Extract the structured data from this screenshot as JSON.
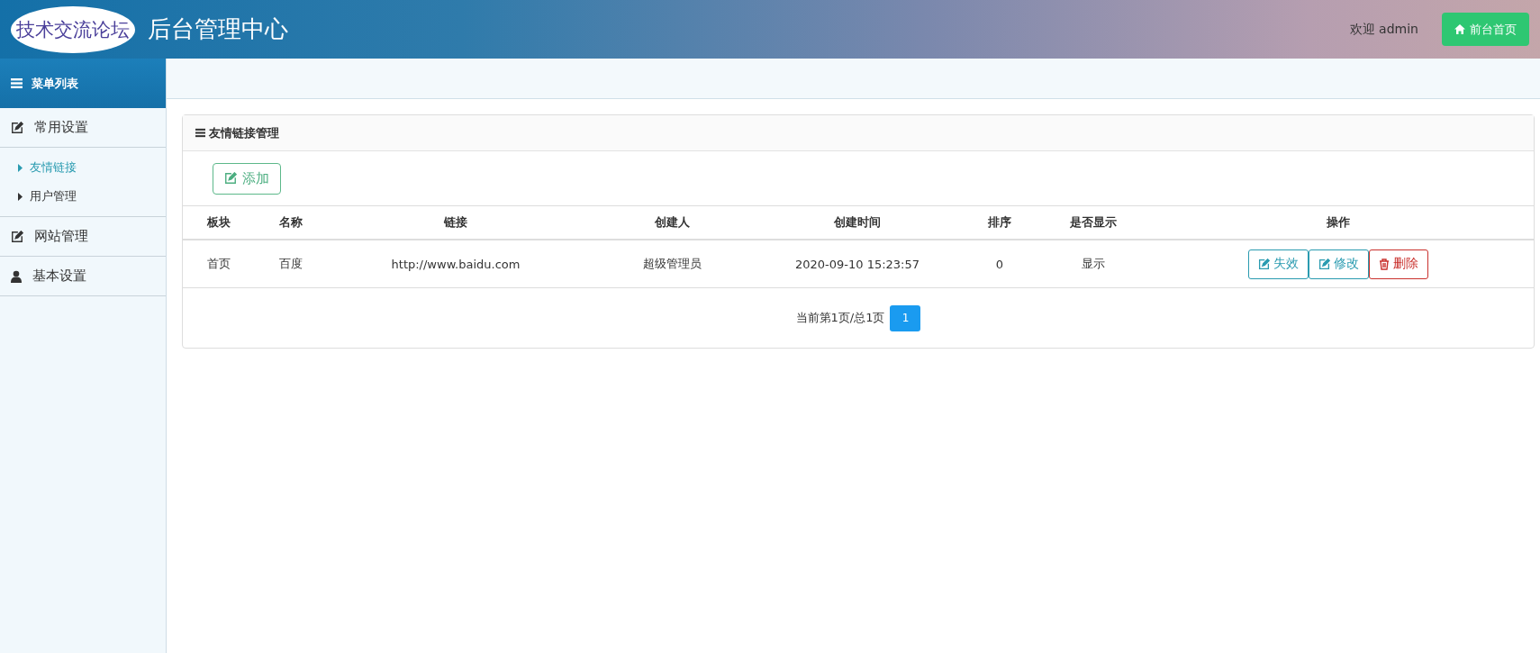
{
  "header": {
    "logo": "技术交流论坛",
    "title": "后台管理中心",
    "welcome": "欢迎 admin",
    "home_button": "前台首页"
  },
  "sidebar": {
    "title": "菜单列表",
    "groups": [
      {
        "label": "常用设置",
        "kind": "edit",
        "children": [
          {
            "label": "友情链接",
            "selected": true
          },
          {
            "label": "用户管理",
            "selected": false
          }
        ]
      },
      {
        "label": "网站管理",
        "kind": "edit"
      },
      {
        "label": "基本设置",
        "kind": "user"
      }
    ]
  },
  "panel": {
    "title": "友情链接管理",
    "add_button": "添加",
    "table": {
      "columns": [
        "板块",
        "名称",
        "链接",
        "创建人",
        "创建时间",
        "排序",
        "是否显示",
        "操作"
      ],
      "rows": [
        {
          "cells": [
            "首页",
            "百度",
            "http://www.baidu.com",
            "超级管理员",
            "2020-09-10 15:23:57",
            "0",
            "显示"
          ],
          "actions": [
            {
              "label": "失效",
              "kind": "edit"
            },
            {
              "label": "修改",
              "kind": "edit"
            },
            {
              "label": "删除",
              "kind": "delete"
            }
          ]
        }
      ]
    },
    "pagination": {
      "summary": "当前第1页/总1页",
      "pages": [
        {
          "label": "1",
          "selected": true
        }
      ]
    }
  }
}
